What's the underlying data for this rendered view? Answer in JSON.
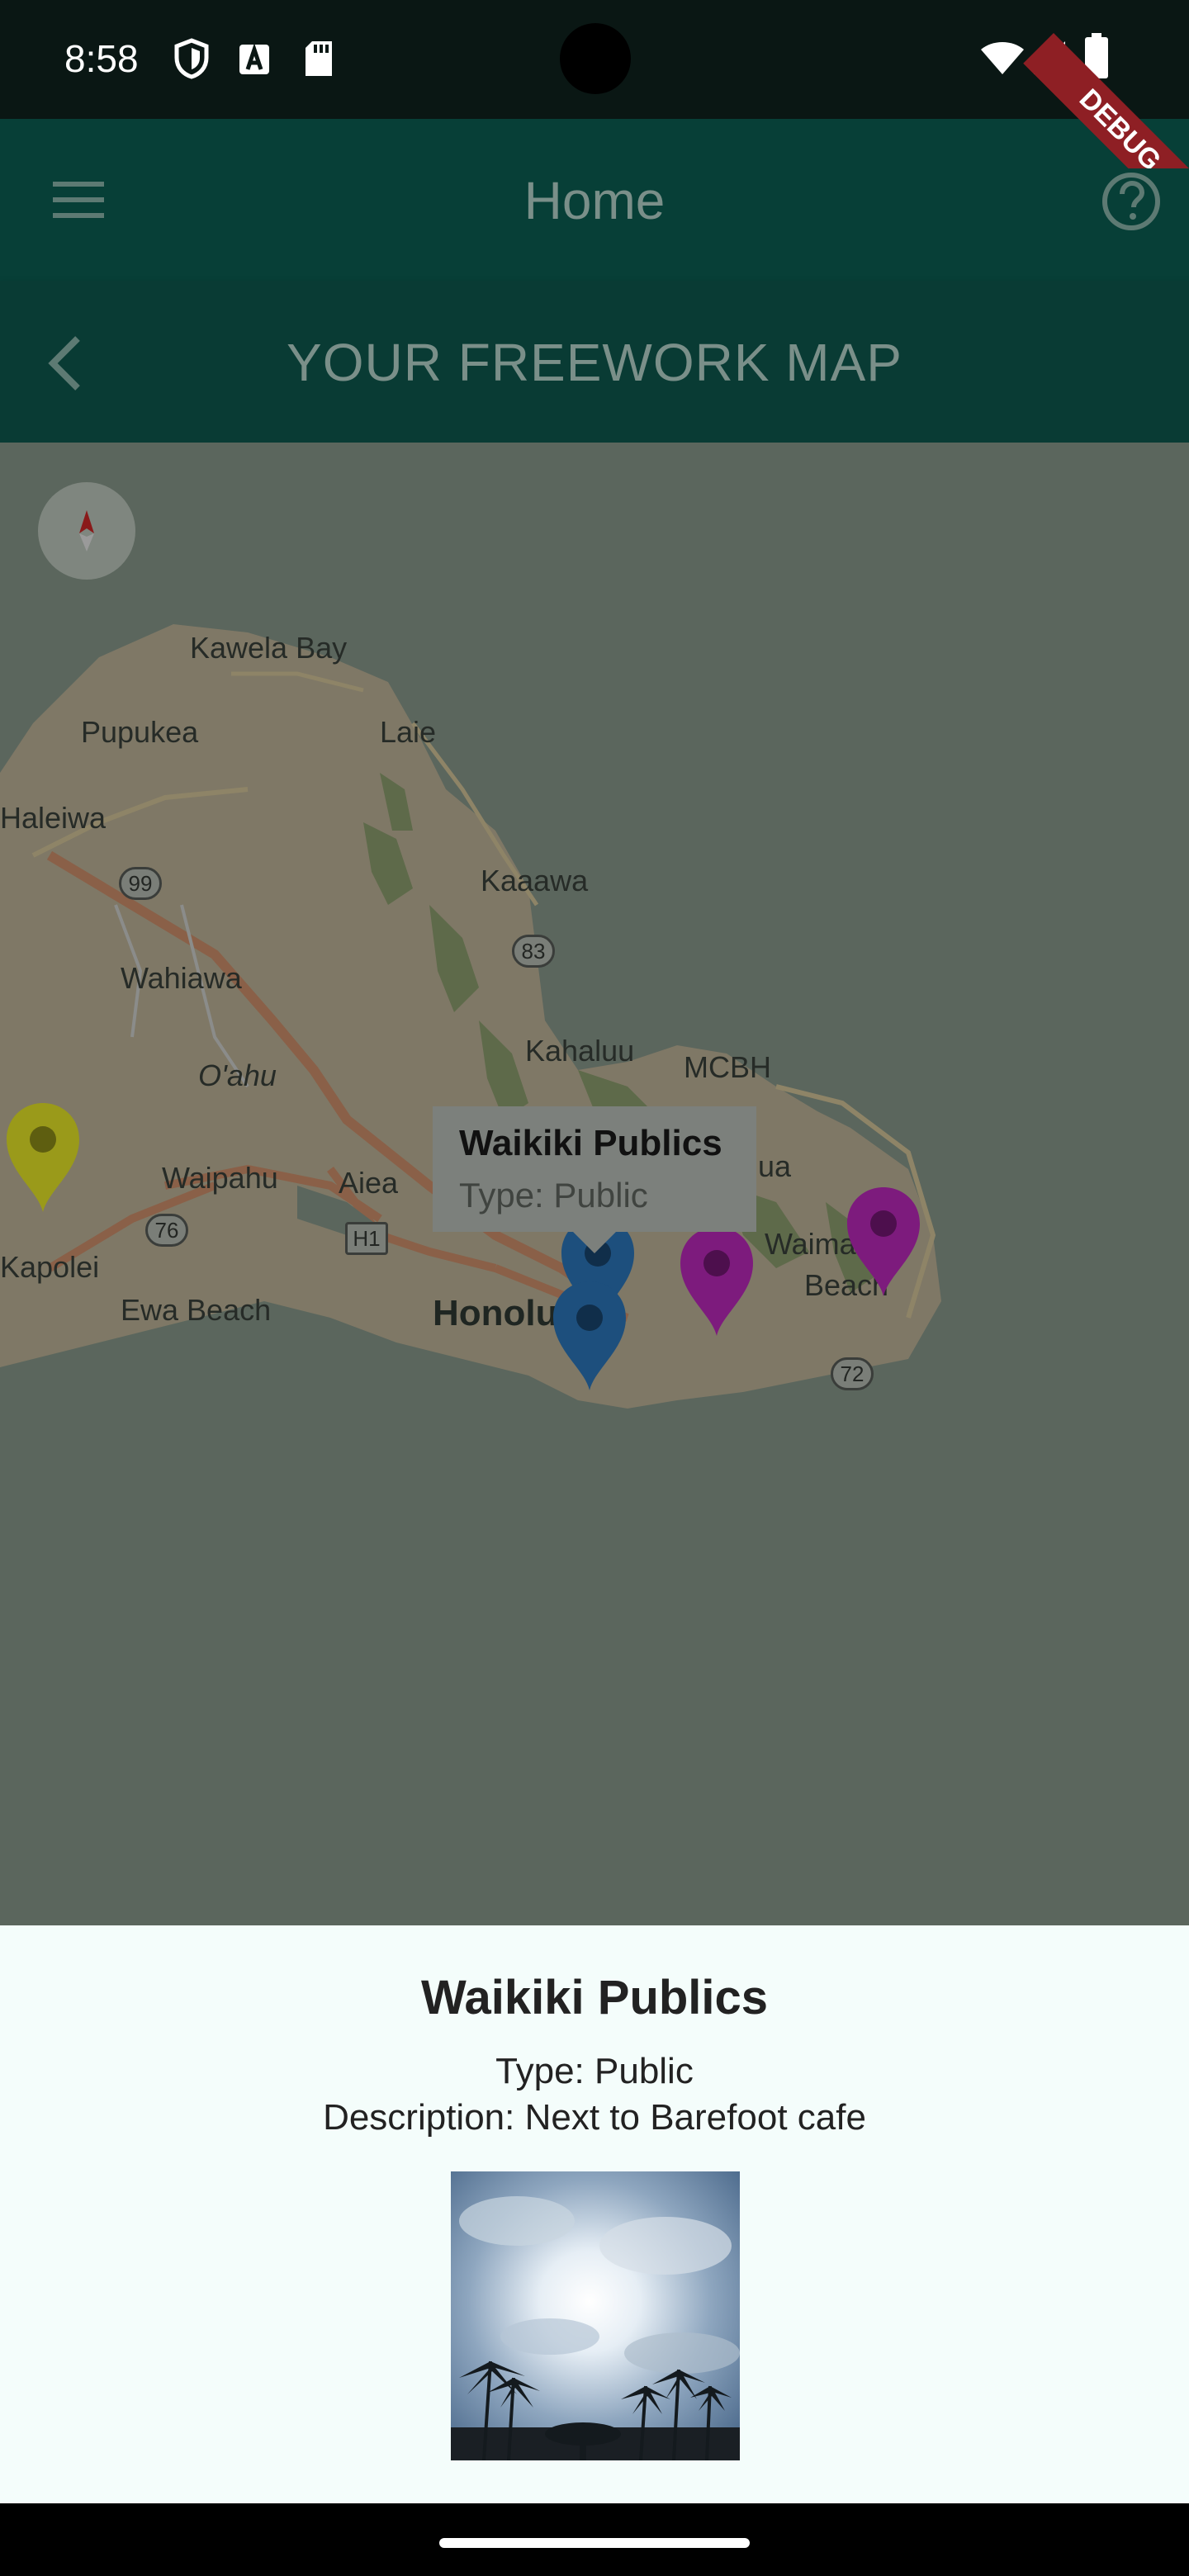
{
  "status_bar": {
    "time": "8:58",
    "left_icons": [
      "shield-icon",
      "text-a-icon",
      "sd-card-icon"
    ],
    "right_icons": [
      "wifi-icon",
      "cell-signal-icon",
      "battery-icon"
    ]
  },
  "app_bar": {
    "title": "Home",
    "menu_icon": "hamburger-menu-icon",
    "help_icon": "help-circle-icon"
  },
  "sub_bar": {
    "title": "YOUR FREEWORK MAP",
    "back_icon": "chevron-left-icon"
  },
  "map": {
    "labels": {
      "kawela_bay": "Kawela Bay",
      "pupukea": "Pupukea",
      "laie": "Laie",
      "haleiwa": "Haleiwa",
      "kaaawa": "Kaaawa",
      "wahiawa": "Wahiawa",
      "oahu": "O'ahu",
      "kahaluu": "Kahaluu",
      "mcbh": "MCBH",
      "waipahu": "Waipahu",
      "aiea": "Aiea",
      "kapolei": "Kapolei",
      "ewa_beach": "Ewa Beach",
      "honolulu": "Honolu",
      "waimanalo": "Waimanalo",
      "beach": "Beach",
      "kailua_fragment": "lua"
    },
    "shields": {
      "r99": "99",
      "r83": "83",
      "r76": "76",
      "h1": "H1",
      "r72": "72"
    },
    "markers": [
      {
        "color": "#9a9a1a",
        "kind": "yellow"
      },
      {
        "color": "#1d4f7d",
        "kind": "blue"
      },
      {
        "color": "#1d4f7d",
        "kind": "blue"
      },
      {
        "color": "#7d1b7d",
        "kind": "purple"
      },
      {
        "color": "#7d1b7d",
        "kind": "purple"
      }
    ],
    "info_window": {
      "title": "Waikiki Publics",
      "type": "Type: Public"
    }
  },
  "sheet": {
    "title": "Waikiki Publics",
    "type": "Type: Public",
    "description": "Description: Next to Barefoot cafe"
  },
  "debug_banner": "DEBUG"
}
